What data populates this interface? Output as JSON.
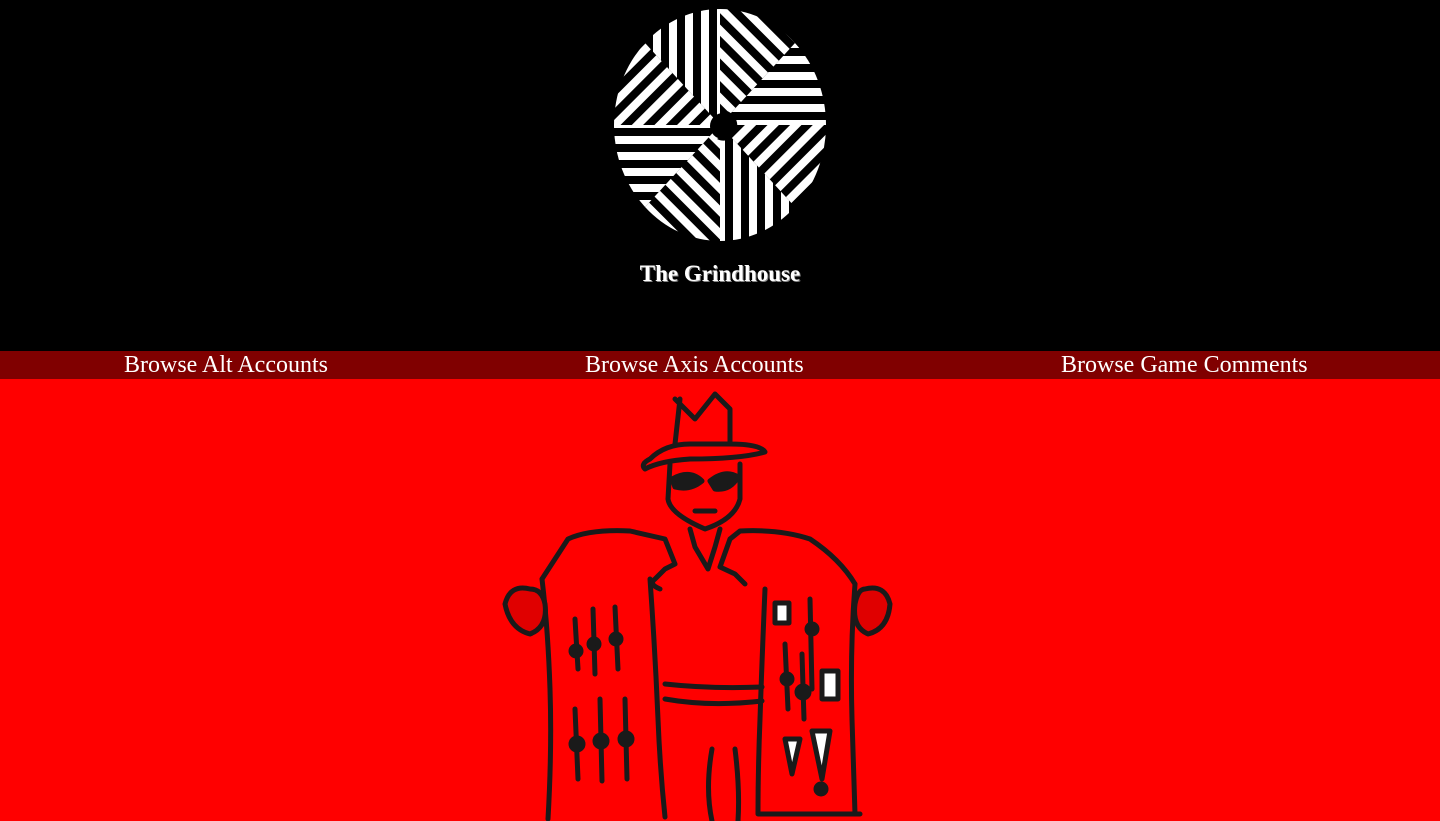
{
  "header": {
    "site_title": "The Grindhouse",
    "logo_icon": "spiral-stripes-logo-icon",
    "background_color": "#000000"
  },
  "nav": {
    "background_color": "#800000",
    "items": [
      {
        "label": "Browse Alt Accounts"
      },
      {
        "label": "Browse Axis Accounts"
      },
      {
        "label": "Browse Game Comments"
      }
    ]
  },
  "main": {
    "background_color": "#ff0000",
    "illustration_icon": "trenchcoat-dealer-illustration"
  }
}
